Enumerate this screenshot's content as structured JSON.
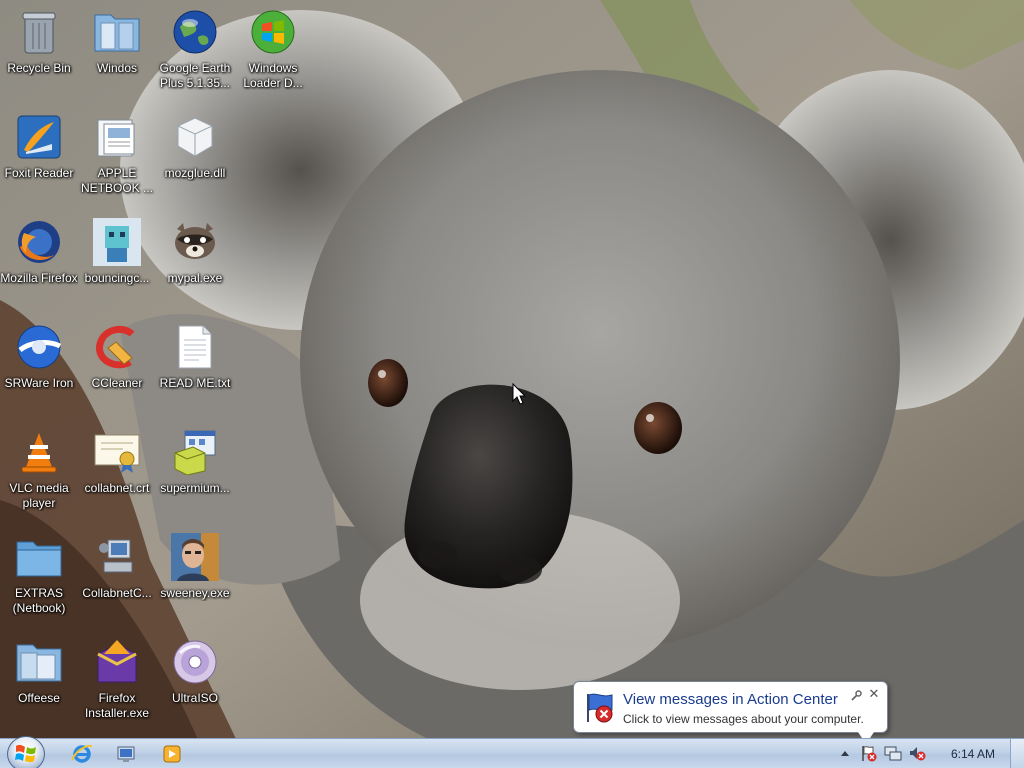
{
  "desktop": {
    "icons": [
      {
        "label": "Recycle Bin",
        "icon": "recycle-bin-icon"
      },
      {
        "label": "Foxit Reader",
        "icon": "foxit-reader-icon"
      },
      {
        "label": "Mozilla Firefox",
        "icon": "firefox-icon"
      },
      {
        "label": "SRWare Iron",
        "icon": "srware-iron-icon"
      },
      {
        "label": "VLC media player",
        "icon": "vlc-icon"
      },
      {
        "label": "EXTRAS (Netbook)",
        "icon": "folder-icon"
      },
      {
        "label": "Offeese",
        "icon": "offeese-icon"
      },
      {
        "label": "Windos",
        "icon": "windos-icon"
      },
      {
        "label": "APPLE NETBOOK ...",
        "icon": "apple-netbook-icon"
      },
      {
        "label": "bouncingc...",
        "icon": "bouncing-icon"
      },
      {
        "label": "CCleaner",
        "icon": "ccleaner-icon"
      },
      {
        "label": "collabnet.crt",
        "icon": "certificate-icon"
      },
      {
        "label": "CollabnetC...",
        "icon": "collabnet-icon"
      },
      {
        "label": "Firefox Installer.exe",
        "icon": "firefox-installer-icon"
      },
      {
        "label": "Google Earth Plus 5.1.35...",
        "icon": "google-earth-icon"
      },
      {
        "label": "mozglue.dll",
        "icon": "dll-file-icon"
      },
      {
        "label": "mypal.exe",
        "icon": "mypal-icon"
      },
      {
        "label": "READ ME.txt",
        "icon": "text-file-icon"
      },
      {
        "label": "supermium...",
        "icon": "installer-icon"
      },
      {
        "label": "sweeney.exe",
        "icon": "sweeney-icon"
      },
      {
        "label": "UltraISO",
        "icon": "ultraiso-icon"
      },
      {
        "label": "Windows Loader D...",
        "icon": "windows-loader-icon"
      }
    ]
  },
  "taskbar": {
    "start_icon": "windows-logo-icon",
    "pinned": [
      {
        "icon": "internet-explorer-icon"
      },
      {
        "icon": "windows-explorer-icon"
      },
      {
        "icon": "media-player-icon"
      }
    ],
    "tray": {
      "icons": [
        "show-hidden-icons-icon",
        "action-center-icon",
        "network-icon",
        "volume-muted-icon"
      ],
      "clock": "6:14 AM"
    }
  },
  "notification": {
    "title": "View messages in Action Center",
    "body": "Click to view messages about your computer.",
    "icon": "action-center-flag-icon"
  },
  "colors": {
    "taskbar": "#c0d2e8",
    "balloon_title": "#1a3c8e"
  }
}
